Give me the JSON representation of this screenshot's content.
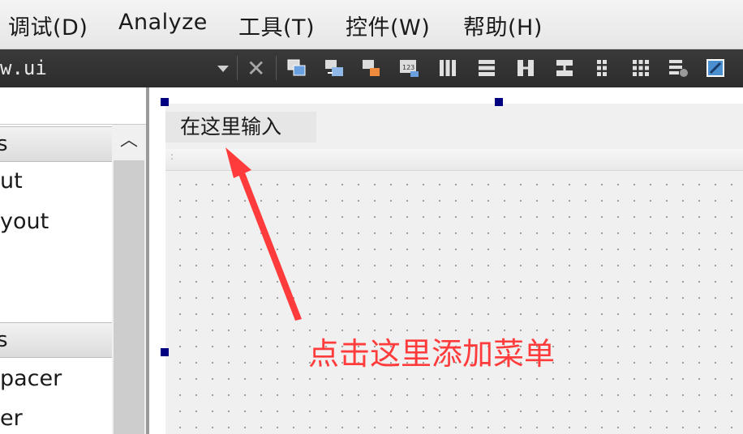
{
  "menubar": {
    "items": [
      {
        "label": "调试(D)",
        "key": "debug"
      },
      {
        "label": "Analyze",
        "key": "analyze"
      },
      {
        "label": "工具(T)",
        "key": "tools"
      },
      {
        "label": "控件(W)",
        "key": "widgets"
      },
      {
        "label": "帮助(H)",
        "key": "help"
      }
    ]
  },
  "toolbar": {
    "file_tab": "w.ui",
    "icons": [
      "edit-widgets-icon",
      "edit-signals-slots-icon",
      "edit-buddies-icon",
      "edit-tab-order-icon",
      "layout-horizontal-icon",
      "layout-vertical-icon",
      "layout-horizontal-splitter-icon",
      "layout-vertical-splitter-icon",
      "layout-form-icon",
      "layout-grid-icon",
      "break-layout-icon",
      "adjust-size-icon"
    ]
  },
  "widget_box": {
    "categories": [
      {
        "title": "s",
        "items": [
          "ut",
          "yout"
        ]
      },
      {
        "title": "s",
        "items": [
          "pacer",
          "er"
        ]
      }
    ]
  },
  "form_editor": {
    "menu_placeholder": "在这里输入"
  },
  "annotation": {
    "text": "点击这里添加菜单",
    "color": "#ff3b3b"
  }
}
